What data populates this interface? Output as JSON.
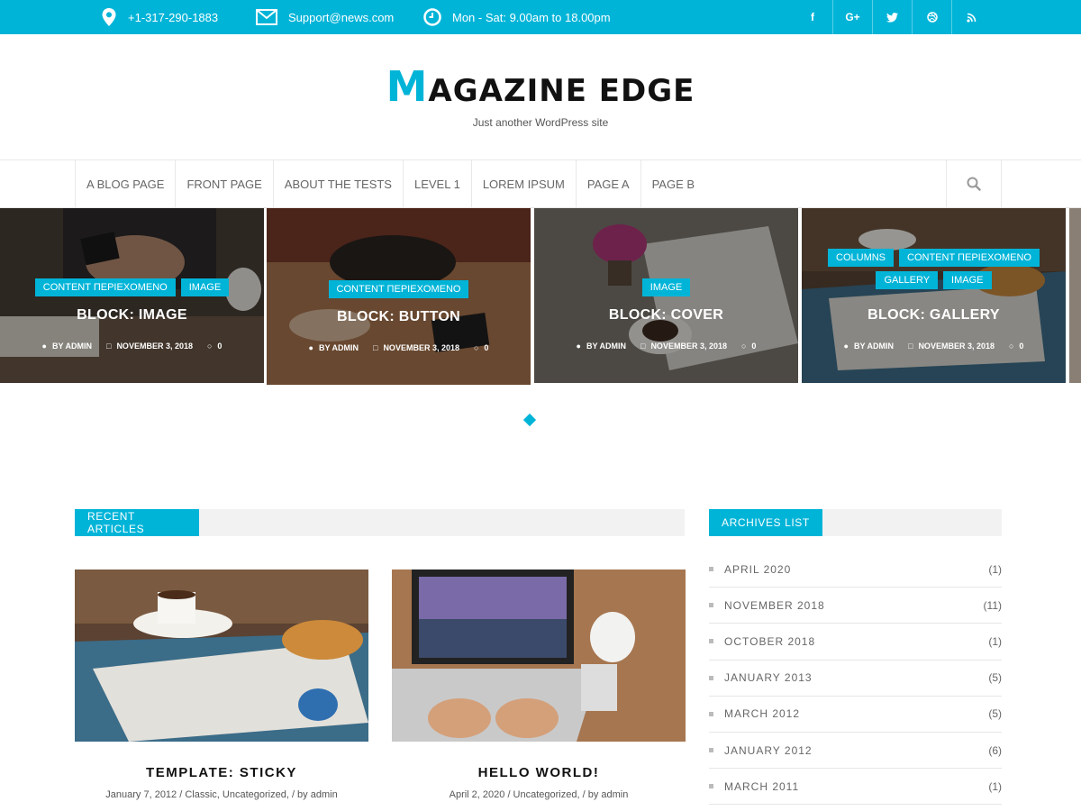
{
  "topbar": {
    "phone": "+1-317-290-1883",
    "email": "Support@news.com",
    "hours": "Mon - Sat: 9.00am to 18.00pm",
    "social": [
      "f",
      "G+",
      "t",
      "d",
      "rss"
    ],
    "background": "#00b4d8"
  },
  "header": {
    "logo_first": "M",
    "logo_rest": "AGAZINE EDGE",
    "tagline": "Just another WordPress site"
  },
  "nav": {
    "items": [
      "A BLOG PAGE",
      "FRONT PAGE",
      "ABOUT THE TESTS",
      "LEVEL 1",
      "LOREM IPSUM",
      "PAGE A",
      "PAGE B"
    ]
  },
  "slider": {
    "slides": [
      {
        "cats": [
          "CONTENT ΠΕΡΙΕΧΟΜΕΝΟ",
          "IMAGE"
        ],
        "title": "BLOCK: IMAGE",
        "author": "BY ADMIN",
        "date": "NOVEMBER 3, 2018",
        "comments": "0"
      },
      {
        "cats": [
          "CONTENT ΠΕΡΙΕΧΟΜΕΝΟ"
        ],
        "title": "BLOCK: BUTTON",
        "author": "BY ADMIN",
        "date": "NOVEMBER 3, 2018",
        "comments": "0"
      },
      {
        "cats": [
          "IMAGE"
        ],
        "title": "BLOCK: COVER",
        "author": "BY ADMIN",
        "date": "NOVEMBER 3, 2018",
        "comments": "0"
      },
      {
        "cats": [
          "COLUMNS",
          "CONTENT ΠΕΡΙΕΧΟΜΕΝΟ",
          "GALLERY",
          "IMAGE"
        ],
        "title": "BLOCK: GALLERY",
        "author": "BY ADMIN",
        "date": "NOVEMBER 3, 2018",
        "comments": "0"
      }
    ]
  },
  "recent": {
    "heading": "RECENT ARTICLES",
    "articles": [
      {
        "title": "TEMPLATE: STICKY",
        "meta": "January 7, 2012 / Classic, Uncategorized, / by admin"
      },
      {
        "title": "HELLO WORLD!",
        "meta": "April 2, 2020 / Uncategorized, / by admin"
      }
    ]
  },
  "archives": {
    "heading": "ARCHIVES LIST",
    "items": [
      {
        "label": "APRIL 2020",
        "count": "(1)"
      },
      {
        "label": "NOVEMBER 2018",
        "count": "(11)"
      },
      {
        "label": "OCTOBER 2018",
        "count": "(1)"
      },
      {
        "label": "JANUARY 2013",
        "count": "(5)"
      },
      {
        "label": "MARCH 2012",
        "count": "(5)"
      },
      {
        "label": "JANUARY 2012",
        "count": "(6)"
      },
      {
        "label": "MARCH 2011",
        "count": "(1)"
      }
    ]
  }
}
